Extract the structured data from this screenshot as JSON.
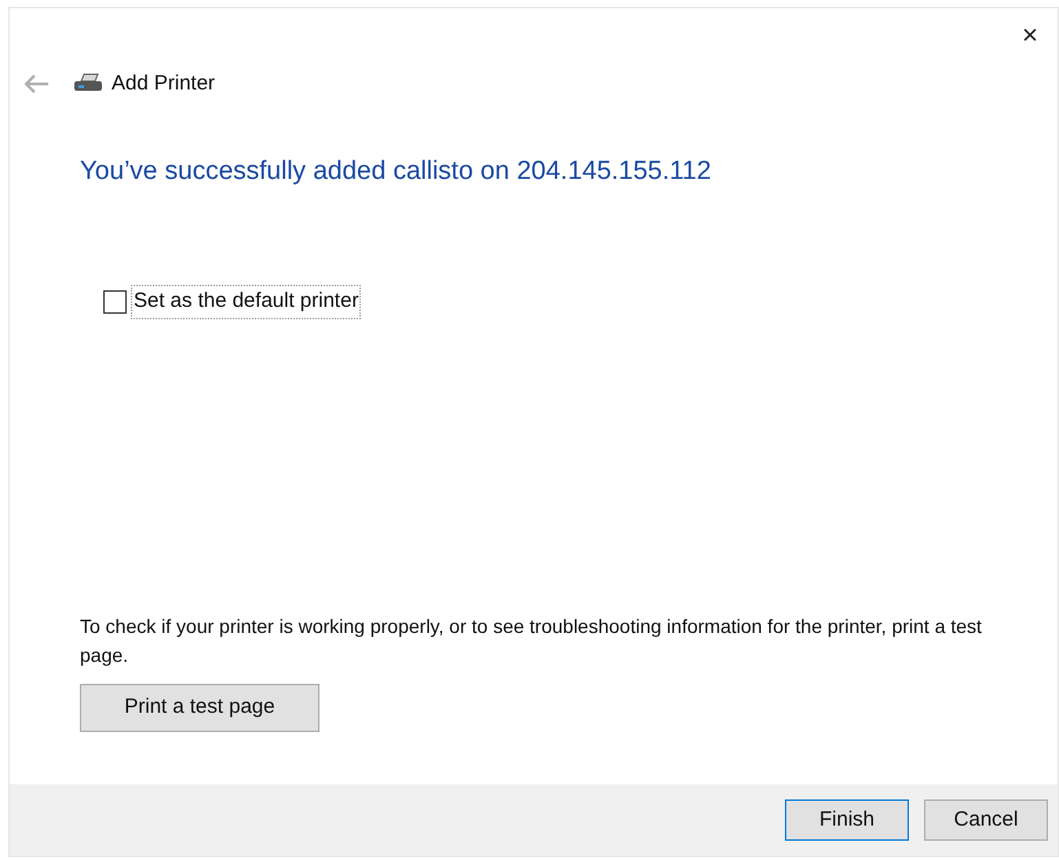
{
  "window": {
    "close": "×",
    "title": "Add Printer"
  },
  "heading": "You’ve successfully added callisto on 204.145.155.112",
  "default_printer": {
    "label": "Set as the default printer",
    "checked": false
  },
  "info": "To check if your printer is working properly, or to see troubleshooting information for the printer, print a test page.",
  "test_button": "Print a test page",
  "buttons": [
    {
      "label": "Finish",
      "selected": true
    },
    {
      "label": "Cancel",
      "selected": false
    }
  ]
}
